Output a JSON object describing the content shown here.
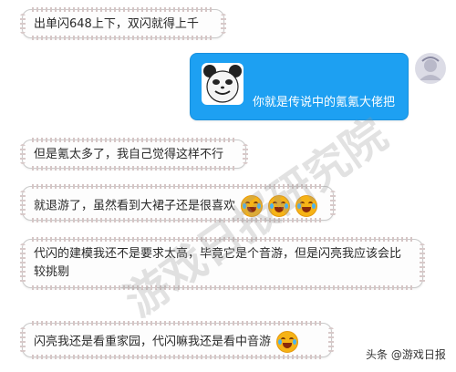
{
  "messages": [
    {
      "side": "left",
      "text": "出单闪648上下，双闪就得上千"
    },
    {
      "side": "right",
      "text": "你就是传说中的氪氪大佬把"
    },
    {
      "side": "left",
      "text": "但是氪太多了，我自己觉得这样不行"
    },
    {
      "side": "left",
      "text": "就退游了，虽然看到大裙子还是很喜欢"
    },
    {
      "side": "left",
      "text": "代闪的建模我还不是要求太高，毕竟它是个音游，但是闪亮我应该会比较挑剔"
    },
    {
      "side": "left",
      "text": "闪亮我还是看重家园，代闪嘛我还是看中音游"
    }
  ],
  "watermark": "游戏日报研究院",
  "footer": {
    "text": "头条 @游戏日报"
  },
  "colors": {
    "accent": "#1da0f2",
    "emoji": "#f6b316"
  },
  "icons": {
    "panda": "panda-face-sticker",
    "emoji": "crying-laughing-emoji",
    "user": "user-avatar-icon"
  }
}
